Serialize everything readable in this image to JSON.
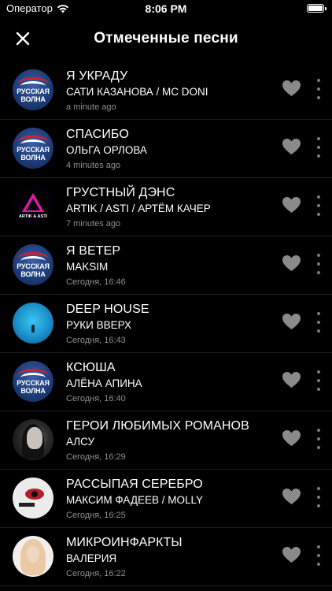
{
  "status": {
    "carrier": "Оператор",
    "time": "8:06 PM"
  },
  "nav": {
    "title": "Отмеченные песни",
    "close_icon": "close-icon"
  },
  "colors": {
    "background": "#000000",
    "secondary_text": "#8e8e93",
    "icon_gray": "#7a7a7a"
  },
  "songs": [
    {
      "title": "Я УКРАДУ",
      "artist": "САТИ КАЗАНОВА / MC DONI",
      "time": "a minute ago",
      "art": "radio",
      "art_l1": "РУССКАЯ",
      "art_l2": "ВОЛНА"
    },
    {
      "title": "СПАСИБО",
      "artist": "ОЛЬГА ОРЛОВА",
      "time": "4 minutes ago",
      "art": "radio",
      "art_l1": "РУССКАЯ",
      "art_l2": "ВОЛНА"
    },
    {
      "title": "ГРУСТНЫЙ ДЭНС",
      "artist": "ARTIK / ASTI / АРТЁМ КАЧЕР",
      "time": "7 minutes ago",
      "art": "triangle",
      "art_caption": "ARTIK & ASTI"
    },
    {
      "title": "Я ВЕТЕР",
      "artist": "MAKSIM",
      "time": "Сегодня, 16:46",
      "art": "radio",
      "art_l1": "РУССКАЯ",
      "art_l2": "ВОЛНА"
    },
    {
      "title": "DEEP HOUSE",
      "artist": "РУКИ ВВЕРХ",
      "time": "Сегодня, 16:43",
      "art": "ocean"
    },
    {
      "title": "КСЮША",
      "artist": "АЛЁНА АПИНА",
      "time": "Сегодня, 16:40",
      "art": "radio",
      "art_l1": "РУССКАЯ",
      "art_l2": "ВОЛНА"
    },
    {
      "title": "ГЕРОИ ЛЮБИМЫХ РОМАНОВ",
      "artist": "АЛСУ",
      "time": "Сегодня, 16:29",
      "art": "portrait-dark"
    },
    {
      "title": "РАССЫПАЯ СЕРЕБРО",
      "artist": "МАКСИМ ФАДЕЕВ / MOLLY",
      "time": "Сегодня, 16:25",
      "art": "portrait-eye"
    },
    {
      "title": "МИКРОИНФАРКТЫ",
      "artist": "ВАЛЕРИЯ",
      "time": "Сегодня, 16:22",
      "art": "portrait-blonde"
    }
  ]
}
